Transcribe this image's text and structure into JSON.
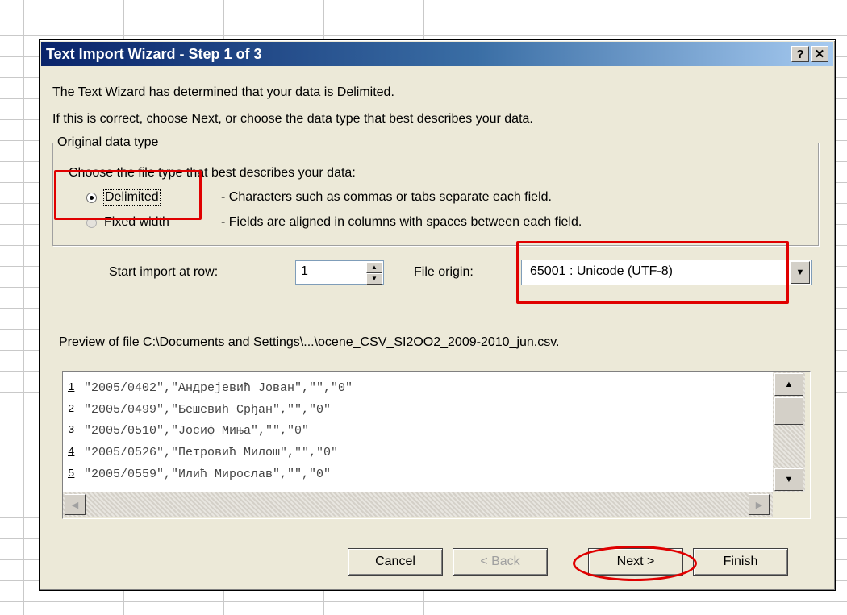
{
  "dialog": {
    "title": "Text Import Wizard - Step 1 of 3",
    "help_button": "?",
    "close_button": "✕"
  },
  "intro": {
    "line1": "The Text Wizard has determined that your data is Delimited.",
    "line2": "If this is correct, choose Next, or choose the data type that best describes your data."
  },
  "original_data_type": {
    "legend": "Original data type",
    "prompt": "Choose the file type that best describes your data:",
    "options": [
      {
        "label": "Delimited",
        "description": "- Characters such as commas or tabs separate each field.",
        "selected": true
      },
      {
        "label": "Fixed width",
        "description": "- Fields are aligned in columns with spaces between each field.",
        "selected": false
      }
    ]
  },
  "start_import": {
    "label": "Start import at row:",
    "value": "1"
  },
  "file_origin": {
    "label": "File origin:",
    "value": "65001 : Unicode (UTF-8)"
  },
  "preview": {
    "label": "Preview of file C:\\Documents and Settings\\...\\ocene_CSV_SI2OO2_2009-2010_jun.csv.",
    "rows": [
      {
        "num": "1",
        "text": "\"2005/0402\",\"Андрејевић Јован\",\"\",\"0\""
      },
      {
        "num": "2",
        "text": "\"2005/0499\",\"Бешевић Срђан\",\"\",\"0\""
      },
      {
        "num": "3",
        "text": "\"2005/0510\",\"Јосиф Миња\",\"\",\"0\""
      },
      {
        "num": "4",
        "text": "\"2005/0526\",\"Петровић Милош\",\"\",\"0\""
      },
      {
        "num": "5",
        "text": "\"2005/0559\",\"Илић Мирослав\",\"\",\"0\""
      }
    ]
  },
  "buttons": {
    "cancel": "Cancel",
    "back": "< Back",
    "next": "Next >",
    "finish": "Finish"
  },
  "colors": {
    "highlight": "#e00000",
    "titlebar": "#0a246a"
  }
}
